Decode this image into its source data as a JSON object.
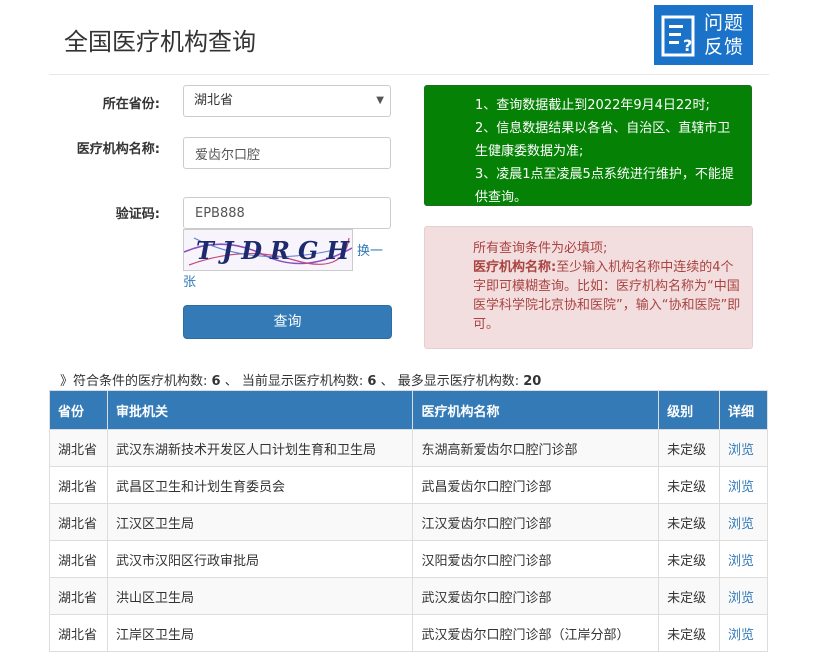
{
  "page": {
    "title": "全国医疗机构查询"
  },
  "feedback": {
    "label_line1": "问题",
    "label_line2": "反馈"
  },
  "form": {
    "province_label": "所在省份:",
    "province_value": "湖北省",
    "name_label": "医疗机构名称:",
    "name_value": "爱齿尔口腔",
    "code_label": "验证码:",
    "code_value": "EPB888",
    "captcha_text": "TJDRGH",
    "refresh_line1": "换一",
    "refresh_line2": "张",
    "query_label": "查询"
  },
  "notice_green": {
    "line1": "1、查询数据截止到2022年9月4日22时;",
    "line2": "2、信息数据结果以各省、自治区、直辖市卫生健康委数据为准;",
    "line3": "3、凌晨1点至凌晨5点系统进行维护，不能提供查询。"
  },
  "notice_red": {
    "line1": "所有查询条件为必填项;",
    "bold_label": "医疗机构名称:",
    "line2": "至少输入机构名称中连续的4个字即可模糊查询。比如：医疗机构名称为“中国医学科学院北京协和医院”，输入“协和医院”即可。"
  },
  "summary": {
    "prefix": "》符合条件的医疗机构数:",
    "match_count": "6",
    "shown_label": "、 当前显示医疗机构数:",
    "shown_count": "6",
    "max_label": "、 最多显示医疗机构数:",
    "max_count": "20"
  },
  "table": {
    "headers": [
      "省份",
      "审批机关",
      "医疗机构名称",
      "级别",
      "详细"
    ],
    "rows": [
      [
        "湖北省",
        "武汉东湖新技术开发区人口计划生育和卫生局",
        "东湖高新爱齿尔口腔门诊部",
        "未定级",
        "浏览"
      ],
      [
        "湖北省",
        "武昌区卫生和计划生育委员会",
        "武昌爱齿尔口腔门诊部",
        "未定级",
        "浏览"
      ],
      [
        "湖北省",
        "江汉区卫生局",
        "江汉爱齿尔口腔门诊部",
        "未定级",
        "浏览"
      ],
      [
        "湖北省",
        "武汉市汉阳区行政审批局",
        "汉阳爱齿尔口腔门诊部",
        "未定级",
        "浏览"
      ],
      [
        "湖北省",
        "洪山区卫生局",
        "武汉爱齿尔口腔门诊部",
        "未定级",
        "浏览"
      ],
      [
        "湖北省",
        "江岸区卫生局",
        "武汉爱齿尔口腔门诊部（江岸分部）",
        "未定级",
        "浏览"
      ]
    ]
  },
  "colors": {
    "primary": "#337ab7",
    "notice_green": "#058205",
    "notice_red_bg": "#f2dede",
    "notice_red_text": "#a94442",
    "feedback_bg": "#1a73c9"
  }
}
